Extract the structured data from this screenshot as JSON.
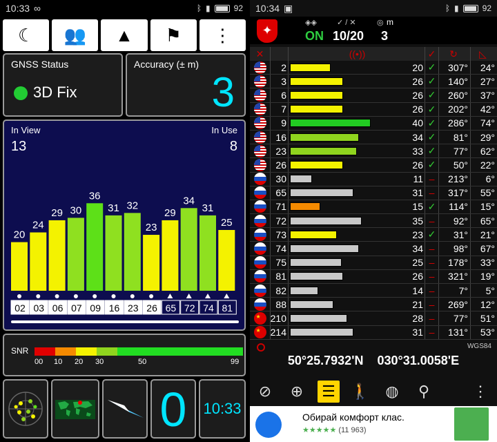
{
  "left": {
    "status": {
      "time": "10:33",
      "battery": "92"
    },
    "toolbar": [
      "moon-icon",
      "people-icon",
      "navigation-arrow-icon",
      "flags-icon",
      "more-vert-icon"
    ],
    "gnss": {
      "label": "GNSS Status",
      "fix": "3D Fix"
    },
    "accuracy": {
      "label": "Accuracy (± m)",
      "value": "3"
    },
    "chart": {
      "in_view_label": "In View",
      "in_view": "13",
      "in_use_label": "In Use",
      "in_use": "8"
    },
    "snr": {
      "label": "SNR",
      "ticks": [
        "00",
        "10",
        "20",
        "30",
        "50",
        "99"
      ]
    },
    "bottom": {
      "zero": "0",
      "clock": "10:33"
    }
  },
  "chart_data": {
    "type": "bar",
    "categories": [
      "02",
      "03",
      "06",
      "07",
      "09",
      "16",
      "23",
      "26",
      "65",
      "72",
      "74",
      "81"
    ],
    "values": [
      20,
      24,
      29,
      30,
      36,
      31,
      32,
      23,
      29,
      34,
      31,
      25
    ],
    "markers": [
      "dot",
      "dot",
      "dot",
      "dot",
      "dot",
      "dot",
      "dot",
      "dot",
      "triangle",
      "triangle",
      "triangle",
      "triangle"
    ],
    "colors": [
      "#f4f200",
      "#f4f200",
      "#f4f200",
      "#8fe020",
      "#5de018",
      "#8fe020",
      "#8fe020",
      "#f4f200",
      "#f4f200",
      "#8fe020",
      "#8fe020",
      "#f4f200"
    ]
  },
  "right": {
    "status": {
      "time": "10:34",
      "battery": "92"
    },
    "header": {
      "state": "ON",
      "used": "10/20",
      "accuracy": "3",
      "acc_unit": "m"
    },
    "rows": [
      {
        "flag": "us",
        "prn": "2",
        "snr": "20",
        "use": true,
        "az": "307°",
        "el": "24°",
        "frac": 0.35,
        "color": "#f4f200"
      },
      {
        "flag": "us",
        "prn": "3",
        "snr": "26",
        "use": true,
        "az": "140°",
        "el": "27°",
        "frac": 0.45,
        "color": "#f4f200"
      },
      {
        "flag": "us",
        "prn": "6",
        "snr": "26",
        "use": true,
        "az": "260°",
        "el": "37°",
        "frac": 0.45,
        "color": "#f4f200"
      },
      {
        "flag": "us",
        "prn": "7",
        "snr": "26",
        "use": true,
        "az": "202°",
        "el": "42°",
        "frac": 0.45,
        "color": "#f4f200"
      },
      {
        "flag": "us",
        "prn": "9",
        "snr": "40",
        "use": true,
        "az": "286°",
        "el": "74°",
        "frac": 0.69,
        "color": "#22cc22"
      },
      {
        "flag": "us",
        "prn": "16",
        "snr": "34",
        "use": true,
        "az": "81°",
        "el": "29°",
        "frac": 0.59,
        "color": "#8fd41e"
      },
      {
        "flag": "us",
        "prn": "23",
        "snr": "33",
        "use": true,
        "az": "77°",
        "el": "62°",
        "frac": 0.57,
        "color": "#8fd41e"
      },
      {
        "flag": "us",
        "prn": "26",
        "snr": "26",
        "use": true,
        "az": "50°",
        "el": "22°",
        "frac": 0.45,
        "color": "#f4f200"
      },
      {
        "flag": "ru",
        "prn": "30",
        "snr": "11",
        "use": false,
        "az": "213°",
        "el": "6°",
        "frac": 0.19,
        "color": "#c8c8c8"
      },
      {
        "flag": "ru",
        "prn": "65",
        "snr": "31",
        "use": false,
        "az": "317°",
        "el": "55°",
        "frac": 0.54,
        "color": "#c8c8c8"
      },
      {
        "flag": "ru",
        "prn": "71",
        "snr": "15",
        "use": true,
        "az": "114°",
        "el": "15°",
        "frac": 0.26,
        "color": "#f58a00"
      },
      {
        "flag": "ru",
        "prn": "72",
        "snr": "35",
        "use": false,
        "az": "92°",
        "el": "65°",
        "frac": 0.61,
        "color": "#c8c8c8"
      },
      {
        "flag": "ru",
        "prn": "73",
        "snr": "23",
        "use": true,
        "az": "31°",
        "el": "21°",
        "frac": 0.4,
        "color": "#f4f200"
      },
      {
        "flag": "ru",
        "prn": "74",
        "snr": "34",
        "use": false,
        "az": "98°",
        "el": "67°",
        "frac": 0.59,
        "color": "#c8c8c8"
      },
      {
        "flag": "ru",
        "prn": "75",
        "snr": "25",
        "use": false,
        "az": "178°",
        "el": "33°",
        "frac": 0.44,
        "color": "#c8c8c8"
      },
      {
        "flag": "ru",
        "prn": "81",
        "snr": "26",
        "use": false,
        "az": "321°",
        "el": "19°",
        "frac": 0.45,
        "color": "#c8c8c8"
      },
      {
        "flag": "ru",
        "prn": "82",
        "snr": "14",
        "use": false,
        "az": "7°",
        "el": "5°",
        "frac": 0.24,
        "color": "#c8c8c8"
      },
      {
        "flag": "ru",
        "prn": "88",
        "snr": "21",
        "use": false,
        "az": "269°",
        "el": "12°",
        "frac": 0.37,
        "color": "#c8c8c8"
      },
      {
        "flag": "cn",
        "prn": "210",
        "snr": "28",
        "use": false,
        "az": "77°",
        "el": "51°",
        "frac": 0.49,
        "color": "#c8c8c8"
      },
      {
        "flag": "cn",
        "prn": "214",
        "snr": "31",
        "use": false,
        "az": "131°",
        "el": "53°",
        "frac": 0.54,
        "color": "#c8c8c8"
      }
    ],
    "wgs": "WGS84",
    "lat": "50°25.7932'N",
    "lon": "030°31.0058'E",
    "ad": {
      "title": "Обирай комфорт клас.",
      "rating": "(11 963)"
    }
  }
}
